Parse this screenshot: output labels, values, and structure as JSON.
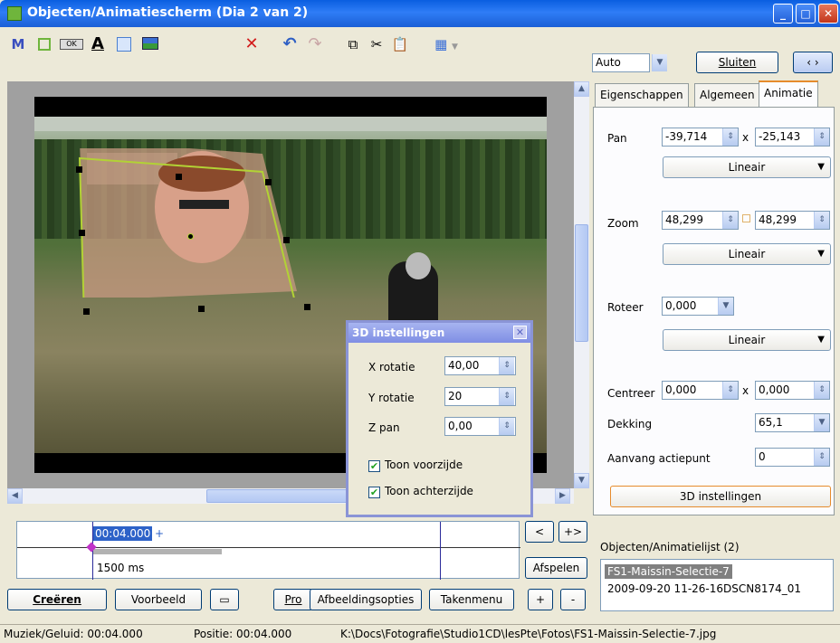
{
  "window": {
    "title": "Objecten/Animatiescherm (Dia 2 van 2)",
    "minimize": "_",
    "maximize": "□",
    "close": "✕"
  },
  "toolbar": {
    "m_label": "M",
    "ok_label": "OK",
    "text_label": "A"
  },
  "top_controls": {
    "zoom_value": "Auto",
    "close_button": "Sluiten",
    "prev_next": "‹ ›"
  },
  "tabs": [
    "Eigenschappen",
    "Algemeen",
    "Animatie"
  ],
  "animatie": {
    "pan_label": "Pan",
    "pan_x": "-39,714",
    "pan_sep": "x",
    "pan_y": "-25,143",
    "pan_mode": "Lineair",
    "zoom_label": "Zoom",
    "zoom_x": "48,299",
    "zoom_y": "48,299",
    "zoom_mode": "Lineair",
    "rotate_label": "Roteer",
    "rotate_value": "0,000",
    "rotate_mode": "Lineair",
    "center_label": "Centreer",
    "center_x": "0,000",
    "center_sep": "x",
    "center_y": "0,000",
    "opacity_label": "Dekking",
    "opacity_value": "65,1",
    "start_label": "Aanvang actiepunt",
    "start_value": "0",
    "three_d_button": "3D instellingen"
  },
  "dialog_3d": {
    "title": "3D instellingen",
    "x_rot_label": "X rotatie",
    "x_rot_value": "40,00",
    "y_rot_label": "Y rotatie",
    "y_rot_value": "20",
    "z_pan_label": "Z pan",
    "z_pan_value": "0,00",
    "front_label": "Toon voorzijde",
    "front_checked": true,
    "back_label": "Toon achterzijde",
    "back_checked": true
  },
  "timeline": {
    "time": "00:04.000",
    "plus": "+",
    "duration": "1500 ms"
  },
  "timeline_buttons": {
    "prev": "<",
    "next": "+>",
    "play": "Afspelen",
    "add": "+",
    "remove": "-"
  },
  "object_list": {
    "title": "Objecten/Animatielijst (2)",
    "items": [
      "FS1-Maissin-Selectie-7",
      "2009-09-20 11-26-16DSCN8174_01"
    ]
  },
  "bottom_buttons": {
    "create": "Creëren",
    "preview": "Voorbeeld",
    "pro": "Pro",
    "image_options": "Afbeeldingsopties",
    "task_menu": "Takenmenu"
  },
  "status": {
    "music": "Muziek/Geluid:  00:04.000",
    "position": "Positie:  00:04.000",
    "path": "K:\\Docs\\Fotografie\\Studio1CD\\lesPte\\Fotos\\FS1-Maissin-Selectie-7.jpg"
  },
  "colors": {
    "title_blue": "#2f7df6",
    "accent_orange": "#e68b2c",
    "selection_green": "#b2d235",
    "dialog_title": "#8a94d6"
  }
}
